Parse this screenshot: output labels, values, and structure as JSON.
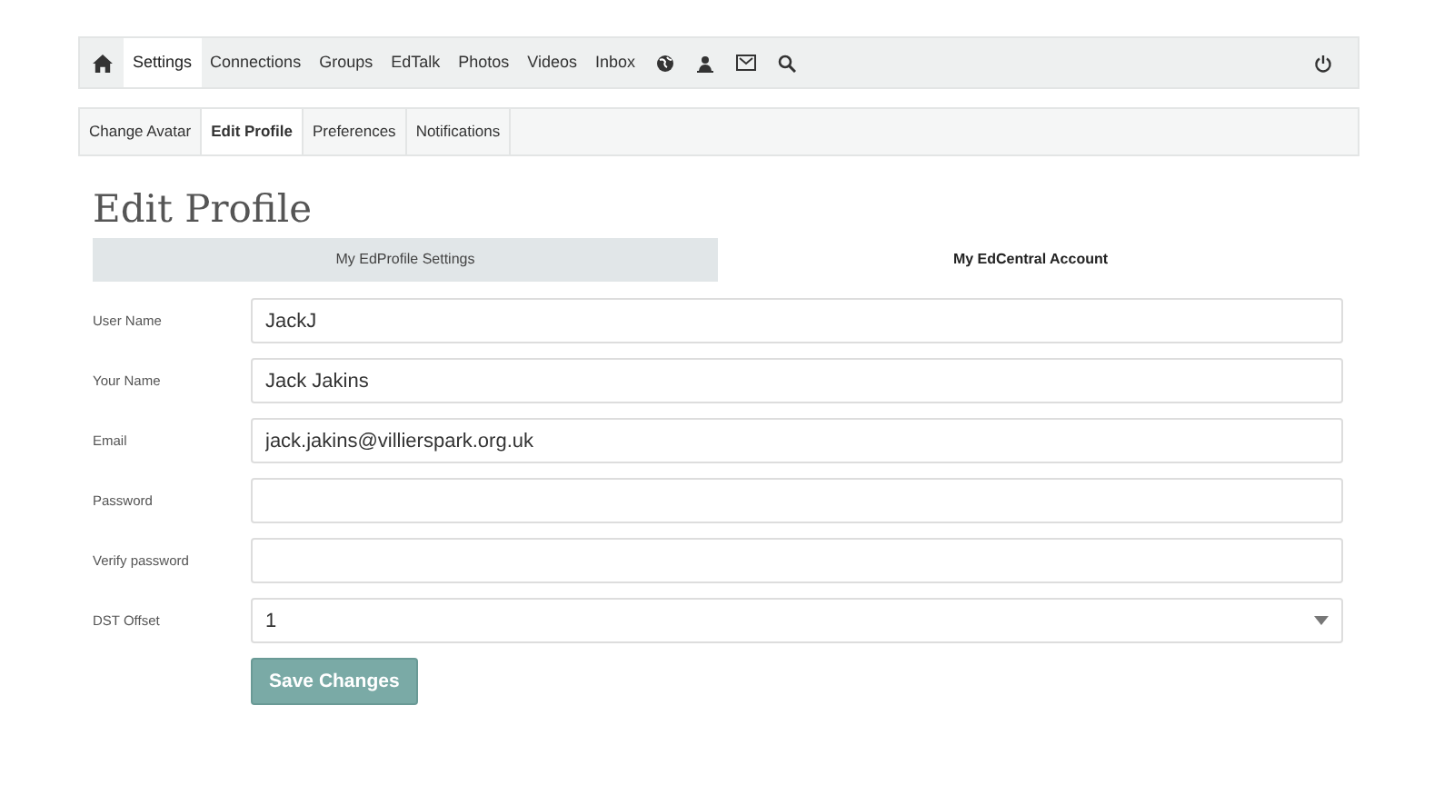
{
  "nav": {
    "items": [
      {
        "label": "Settings",
        "selected": true
      },
      {
        "label": "Connections",
        "selected": false
      },
      {
        "label": "Groups",
        "selected": false
      },
      {
        "label": "EdTalk",
        "selected": false
      },
      {
        "label": "Photos",
        "selected": false
      },
      {
        "label": "Videos",
        "selected": false
      },
      {
        "label": "Inbox",
        "selected": false
      }
    ]
  },
  "subnav": [
    {
      "label": "Change Avatar",
      "selected": false
    },
    {
      "label": "Edit Profile",
      "selected": true
    },
    {
      "label": "Preferences",
      "selected": false
    },
    {
      "label": "Notifications",
      "selected": false
    }
  ],
  "title": "Edit Profile",
  "tabs": [
    {
      "label": "My EdProfile Settings",
      "selected": false
    },
    {
      "label": "My EdCentral Account",
      "selected": true
    }
  ],
  "fields": [
    {
      "kind": "text",
      "label": "User Name",
      "value": "JackJ"
    },
    {
      "kind": "text",
      "label": "Your Name",
      "value": "Jack Jakins"
    },
    {
      "kind": "text",
      "label": "Email",
      "value": "jack.jakins@villierspark.org.uk"
    },
    {
      "kind": "password",
      "label": "Password"
    },
    {
      "kind": "password",
      "label": "Verify password"
    },
    {
      "kind": "select",
      "label": "DST Offset",
      "value": "1"
    }
  ],
  "save_button": "Save Changes"
}
